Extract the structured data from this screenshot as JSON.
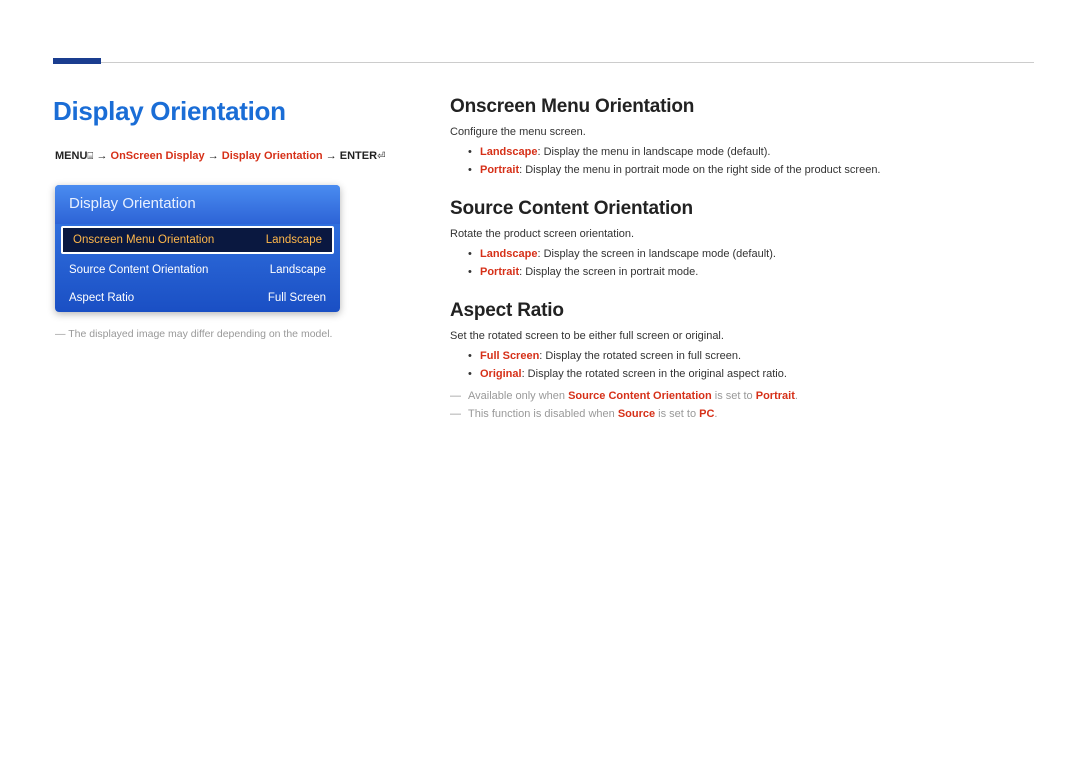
{
  "page": {
    "title": "Display Orientation"
  },
  "breadcrumb": {
    "menu": "MENU",
    "arrow": " → ",
    "p1": "OnScreen Display",
    "p2": "Display Orientation",
    "enter": "ENTER"
  },
  "menu": {
    "header": "Display Orientation",
    "rows": [
      {
        "label": "Onscreen Menu Orientation",
        "value": "Landscape"
      },
      {
        "label": "Source Content Orientation",
        "value": "Landscape"
      },
      {
        "label": "Aspect Ratio",
        "value": "Full Screen"
      }
    ]
  },
  "caption": "The displayed image may differ depending on the model.",
  "sections": [
    {
      "heading": "Onscreen Menu Orientation",
      "intro": "Configure the menu screen.",
      "bullets": [
        {
          "key": "Landscape",
          "text": ": Display the menu in landscape mode (default)."
        },
        {
          "key": "Portrait",
          "text": ": Display the menu in portrait mode on the right side of the product screen."
        }
      ],
      "notes": []
    },
    {
      "heading": "Source Content Orientation",
      "intro": "Rotate the product screen orientation.",
      "bullets": [
        {
          "key": "Landscape",
          "text": ": Display the screen in landscape mode (default)."
        },
        {
          "key": "Portrait",
          "text": ": Display the screen in portrait mode."
        }
      ],
      "notes": []
    },
    {
      "heading": "Aspect Ratio",
      "intro": "Set the rotated screen to be either full screen or original.",
      "bullets": [
        {
          "key": "Full Screen",
          "text": ": Display the rotated screen in full screen."
        },
        {
          "key": "Original",
          "text": ": Display the rotated screen in the original aspect ratio."
        }
      ],
      "notes": [
        {
          "pre": "Available only when ",
          "k1": "Source Content Orientation",
          "mid": " is set to ",
          "k2": "Portrait",
          "post": "."
        },
        {
          "pre": "This function is disabled when ",
          "k1": "Source",
          "mid": " is set to ",
          "k2": "PC",
          "post": "."
        }
      ]
    }
  ]
}
